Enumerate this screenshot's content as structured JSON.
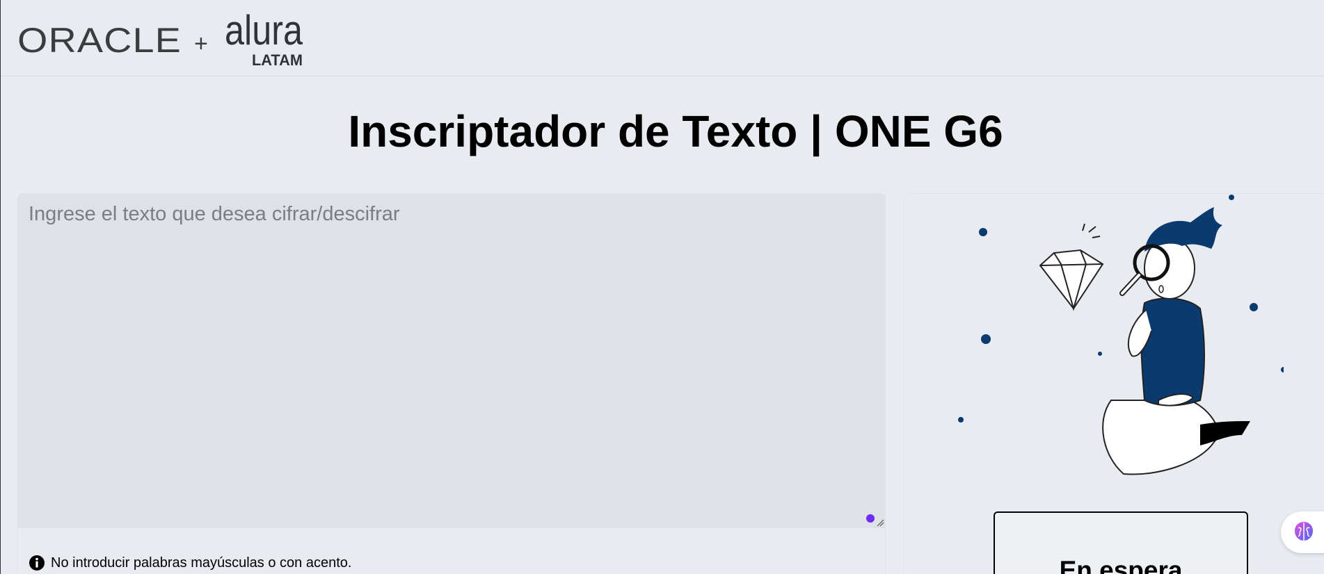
{
  "header": {
    "logo_oracle": "ORACLE",
    "logo_plus": "+",
    "logo_alura": "alura",
    "logo_latam": "LATAM"
  },
  "main": {
    "title": "Inscriptador de Texto | ONE G6",
    "input_placeholder": "Ingrese el texto que desea cifrar/descifrar",
    "input_value": "",
    "note": "No introducir palabras mayúsculas o con acento."
  },
  "output": {
    "status_label": "En espera"
  },
  "icons": {
    "info": "info-icon",
    "brain": "brain-icon",
    "grammarly": "grammarly-dot-icon"
  },
  "colors": {
    "background": "#e8ecf0",
    "textarea_bg": "#dee1e5",
    "accent_navy": "#0b3a6f",
    "grammarly_purple": "#6e2cf2"
  }
}
